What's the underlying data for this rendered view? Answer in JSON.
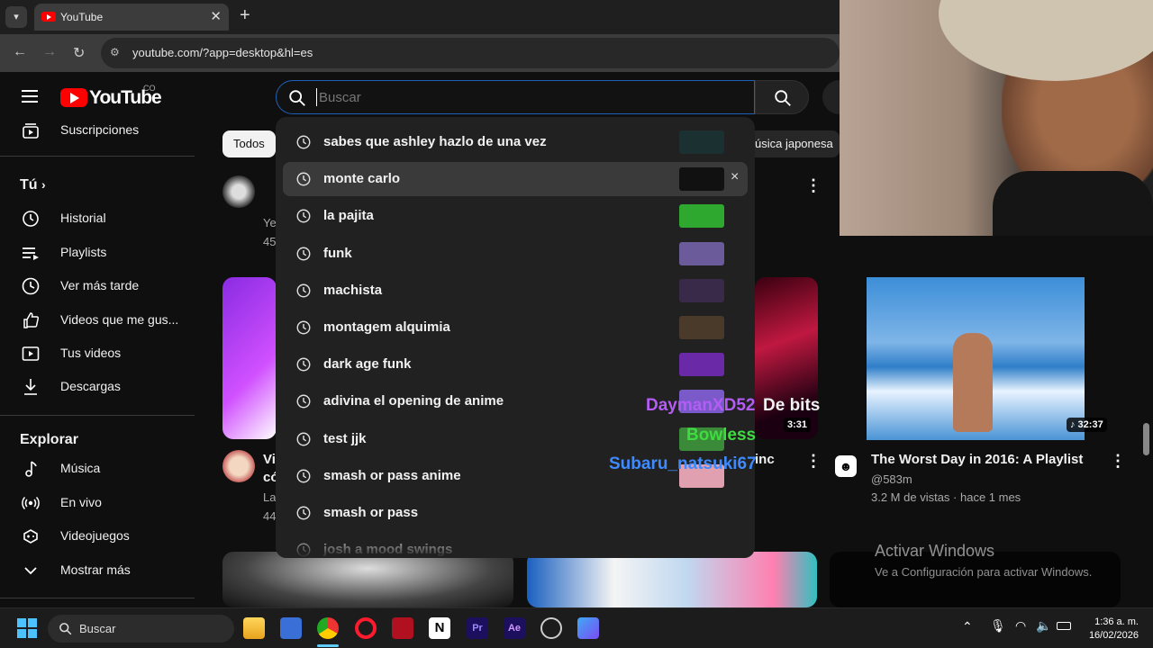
{
  "browser": {
    "tab_title": "YouTube",
    "url": "youtube.com/?app=desktop&hl=es"
  },
  "youtube": {
    "logo_text": "YouTube",
    "country_code": "CO",
    "search_placeholder": "Buscar"
  },
  "sidebar": {
    "subscriptions": "Suscripciones",
    "you_heading": "Tú",
    "you_items": [
      "Historial",
      "Playlists",
      "Ver más tarde",
      "Videos que me gus...",
      "Tus videos",
      "Descargas"
    ],
    "explore_heading": "Explorar",
    "explore_items": [
      "Música",
      "En vivo",
      "Videojuegos",
      "Mostrar más"
    ]
  },
  "chips": {
    "first": "Todos",
    "partial": "úsica japonesa"
  },
  "search_suggestions": [
    "sabes que ashley hazlo de una vez",
    "monte carlo",
    "la pajita",
    "funk",
    "machista",
    "montagem alquimia",
    "dark age funk",
    "adivina el opening de anime",
    "test jjk",
    "smash or pass anime",
    "smash or pass",
    "josh a mood swings"
  ],
  "remove_glyph": "×",
  "partial_feed": {
    "row1_meta1": "Ye",
    "row1_meta2": "45",
    "row2_title1": "Vi",
    "row2_title2": "có",
    "row2_meta1": "La",
    "row2_meta2": "44",
    "mid_title_fragment": "De bits",
    "mid_duration": "3:31",
    "mid_title2_fragment": "inc"
  },
  "featured_video": {
    "title": "The Worst Day in 2016: A Playlist",
    "channel": "@583m",
    "stats": "3.2 M de vistas · hace 1 mes",
    "duration": "♪ 32:37"
  },
  "stream_overlay_names": [
    {
      "name": "DaymanXD52",
      "color": "#b45cf5"
    },
    {
      "name": "Bowless",
      "color": "#3fdc3f"
    },
    {
      "name": "Subaru_natsuki67",
      "color": "#3e8bff"
    }
  ],
  "watermark": {
    "title": "Activar Windows",
    "subtitle": "Ve a Configuración para activar Windows."
  },
  "taskbar": {
    "search": "Buscar",
    "time": "1:36 a. m.",
    "date": "16/02/2026"
  }
}
